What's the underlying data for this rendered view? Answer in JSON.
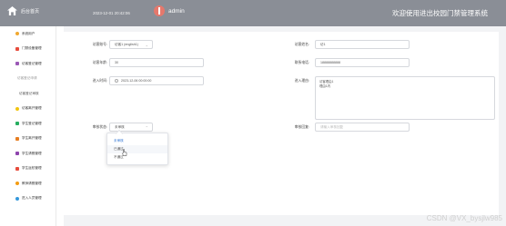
{
  "header": {
    "home_label": "后台首页",
    "datetime": "2023-12-01 20:42:06",
    "username": "admin",
    "system_title": "欢迎使用进出校园门禁管理系统"
  },
  "sidebar": {
    "items": [
      {
        "label": "系统用户",
        "icon": "gear-icon",
        "color": "#f0a830"
      },
      {
        "label": "门禁设备管理",
        "icon": "door-icon",
        "color": "#e74c3c"
      },
      {
        "label": "访客登记管理",
        "icon": "list-icon",
        "color": "#9b59b6"
      },
      {
        "label": "访客登记申请",
        "icon": "",
        "color": ""
      },
      {
        "label": "访客登记审核",
        "icon": "",
        "color": ""
      },
      {
        "label": "访客离开管理",
        "icon": "exit-icon",
        "color": "#f1c40f"
      },
      {
        "label": "学生登记管理",
        "icon": "student-icon",
        "color": "#27ae60"
      },
      {
        "label": "学生离开管理",
        "icon": "leave-icon",
        "color": "#e67e22"
      },
      {
        "label": "学生请假管理",
        "icon": "calendar-icon",
        "color": "#8e44ad"
      },
      {
        "label": "学生返校管理",
        "icon": "return-icon",
        "color": "#e74c3c"
      },
      {
        "label": "教师请假管理",
        "icon": "teacher-icon",
        "color": "#f39c12"
      },
      {
        "label": "进入人员管理",
        "icon": "star-icon",
        "color": "#3498db"
      }
    ]
  },
  "form": {
    "visitor_account_label": "访客账号:",
    "visitor_account_value": "访客1 (english1)",
    "visitor_name_label": "访客姓名:",
    "visitor_name_value": "访1",
    "visitor_age_label": "访客年龄:",
    "visitor_age_value": "30",
    "phone_label": "联系电话:",
    "phone_value": "18888888888",
    "enter_time_label": "进入时间:",
    "enter_time_value": "2023-12-06 00:00:00",
    "enter_reason_label": "进入理由:",
    "enter_reason_line1": "访客理由1",
    "enter_reason_line2": "理由1内",
    "audit_status_label": "审核状态:",
    "audit_status_value": "未审核",
    "audit_reply_label": "审核回复:",
    "audit_reply_placeholder": "请输入审核回复"
  },
  "dropdown": {
    "options": [
      "未审核",
      "已通过",
      "不通过"
    ]
  },
  "watermark": "CSDN @VX_bysjlw985"
}
